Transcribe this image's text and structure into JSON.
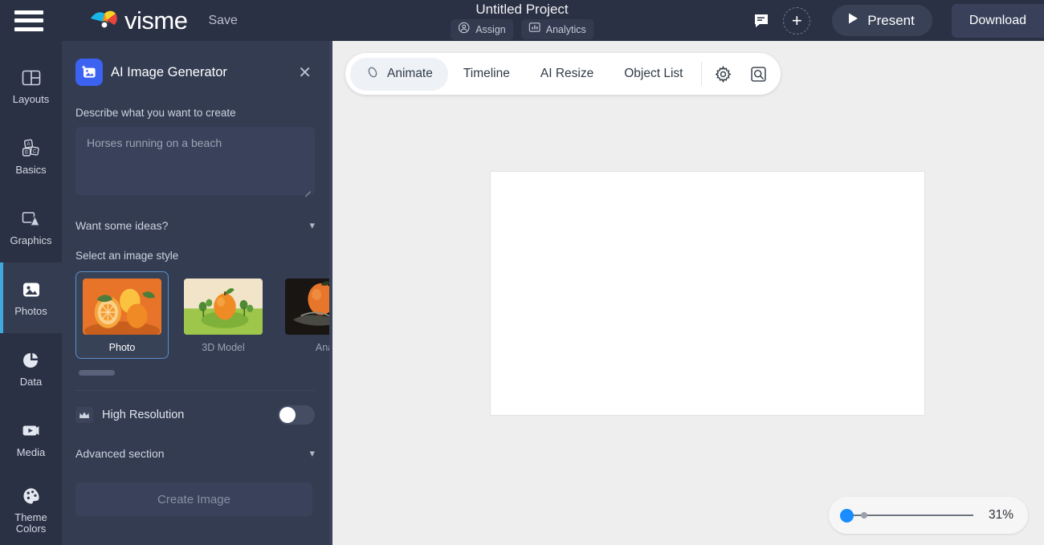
{
  "topbar": {
    "menu_icon": "hamburger-menu-icon",
    "brand": "visme",
    "save_label": "Save",
    "project_title": "Untitled Project",
    "pills": [
      {
        "icon": "assign-user-icon",
        "label": "Assign"
      },
      {
        "icon": "analytics-chart-icon",
        "label": "Analytics"
      }
    ],
    "comment_icon": "comment-icon",
    "add_icon": "add-plus-icon",
    "present_label": "Present",
    "present_icon": "play-icon",
    "download_label": "Download"
  },
  "sidebar": {
    "items": [
      {
        "label": "Layouts",
        "icon": "layouts-icon",
        "active": false
      },
      {
        "label": "Basics",
        "icon": "basics-blocks-icon",
        "active": false
      },
      {
        "label": "Graphics",
        "icon": "graphics-icon",
        "active": false
      },
      {
        "label": "Photos",
        "icon": "photos-image-icon",
        "active": true
      },
      {
        "label": "Data",
        "icon": "data-piechart-icon",
        "active": false
      },
      {
        "label": "Media",
        "icon": "media-video-icon",
        "active": false
      },
      {
        "label": "Theme\nColors",
        "label_line1": "Theme",
        "label_line2": "Colors",
        "icon": "theme-palette-icon",
        "active": false
      }
    ]
  },
  "panel": {
    "icon": "ai-image-generator-icon",
    "title": "AI Image Generator",
    "close_icon": "close-icon",
    "prompt_label": "Describe what you want to create",
    "prompt_value": "",
    "prompt_placeholder": "Horses running on a beach",
    "ideas_label": "Want some ideas?",
    "ideas_chevron": "chevron-down-icon",
    "style_label": "Select an image style",
    "styles": [
      {
        "name": "Photo",
        "selected": true
      },
      {
        "name": "3D Model",
        "selected": false
      },
      {
        "name": "Ana",
        "selected": false
      }
    ],
    "high_resolution_label": "High Resolution",
    "high_resolution_icon": "crown-premium-icon",
    "high_resolution_on": false,
    "advanced_label": "Advanced section",
    "advanced_chevron": "chevron-down-icon",
    "create_label": "Create Image"
  },
  "workspace": {
    "tabs": [
      {
        "label": "Animate",
        "icon": "animate-icon",
        "active": true
      },
      {
        "label": "Timeline",
        "icon": "",
        "active": false
      },
      {
        "label": "AI Resize",
        "icon": "",
        "active": false
      },
      {
        "label": "Object List",
        "icon": "",
        "active": false
      }
    ],
    "tools": [
      {
        "icon": "settings-gear-icon"
      },
      {
        "icon": "zoom-search-icon"
      }
    ],
    "zoom_value": "31%",
    "zoom_percent": 31
  },
  "colors": {
    "topbar_bg": "#2b3144",
    "panel_bg": "#333c51",
    "accent_blue": "#3b62f0",
    "active_rail": "#3fa9e0",
    "workspace_bg": "#eeeeee",
    "slider_blue": "#1a8cff"
  }
}
